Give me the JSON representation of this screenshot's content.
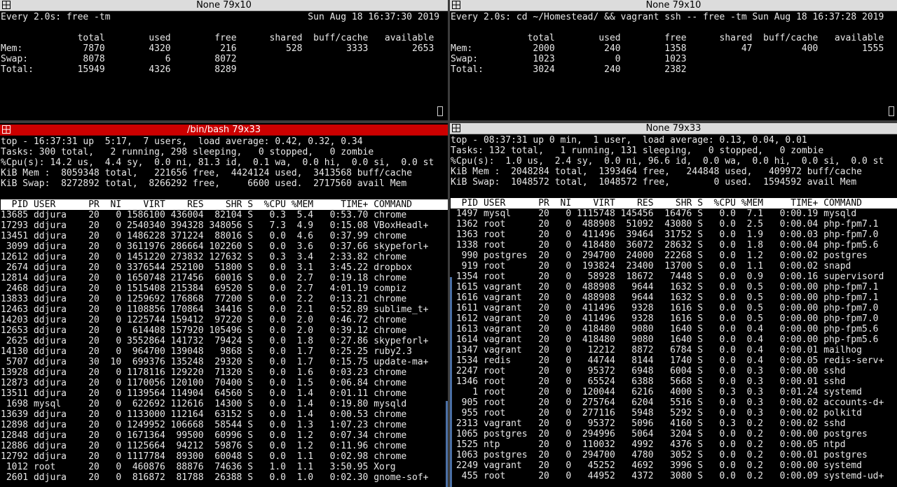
{
  "panes": {
    "top_left": {
      "title": "None 79x10",
      "lines": [
        "Every 2.0s: free -tm                                    Sun Aug 18 16:37:30 2019",
        "",
        "              total        used        free      shared  buff/cache   available",
        "Mem:           7870        4320         216         528        3333        2653",
        "Swap:          8078           6        8072",
        "Total:        15949        4326        8289"
      ]
    },
    "top_right": {
      "title": "None 79x10",
      "lines": [
        "Every 2.0s: cd ~/Homestead/ && vagrant ssh -- free -tm Sun Aug 18 16:37:28 2019",
        "",
        "              total        used        free      shared  buff/cache   available",
        "Mem:           2000         240        1358          47         400        1555",
        "Swap:          1023           0        1023",
        "Total:         3024         240        2382"
      ]
    },
    "bottom_left": {
      "title": "/bin/bash 79x33",
      "summary": [
        "top - 16:37:31 up  5:17,  7 users,  load average: 0.42, 0.32, 0.34",
        "Tasks: 300 total,   2 running, 298 sleeping,   0 stopped,   0 zombie",
        "%Cpu(s): 14.2 us,  4.4 sy,  0.0 ni, 81.3 id,  0.1 wa,  0.0 hi,  0.0 si,  0.0 st",
        "KiB Mem :  8059348 total,   221656 free,  4424124 used,  3413568 buff/cache",
        "KiB Swap:  8272892 total,  8266292 free,     6600 used.  2717560 avail Mem",
        ""
      ],
      "header": "  PID USER      PR  NI    VIRT    RES    SHR S  %CPU %MEM     TIME+ COMMAND     ",
      "rows": [
        "13685 ddjura    20   0 1586100 436004  82104 S   0.3  5.4   0:53.70 chrome",
        "17293 ddjura    20   0 2540340 394328 348056 S   7.3  4.9   0:15.08 VBoxHeadl+",
        "13451 ddjura    20   0 1486228 371224  88016 S   0.0  4.6   0:37.99 chrome",
        " 3099 ddjura    20   0 3611976 286664 102260 S   0.0  3.6   0:37.66 skypeforl+",
        "12612 ddjura    20   0 1451220 273832 127632 S   0.3  3.4   2:33.82 chrome",
        " 2674 ddjura    20   0 3376544 252100  51800 S   0.0  3.1   3:45.22 dropbox",
        "12814 ddjura    20   0 1650748 217456  60016 S   0.0  2.7   0:19.18 chrome",
        " 2468 ddjura    20   0 1515408 215384  69520 S   0.0  2.7   4:01.19 compiz",
        "13833 ddjura    20   0 1259692 176868  77200 S   0.0  2.2   0:13.21 chrome",
        "12463 ddjura    20   0 1108856 170864  34416 S   0.0  2.1   0:52.89 sublime_t+",
        "14203 ddjura    20   0 1225744 159412  97220 S   0.0  2.0   0:46.72 chrome",
        "12653 ddjura    20   0  614408 157920 105496 S   0.0  2.0   0:39.12 chrome",
        " 2625 ddjura    20   0 3552864 141732  79424 S   0.0  1.8   0:27.86 skypeforl+",
        "14130 ddjura    20   0  964700 139048   9868 S   0.0  1.7   0:25.25 ruby2.3",
        " 5707 ddjura    30  10  699376 135248  29320 S   0.0  1.7   0:15.75 update-ma+",
        "13928 ddjura    20   0 1178116 129220  71320 S   0.0  1.6   0:03.23 chrome",
        "12873 ddjura    20   0 1170056 120100  70400 S   0.0  1.5   0:06.84 chrome",
        "13511 ddjura    20   0 1139564 114904  64560 S   0.0  1.4   0:01.11 chrome",
        " 1698 mysql     20   0  622692 112616  14300 S   0.0  1.4   0:19.80 mysqld",
        "13639 ddjura    20   0 1133000 112164  63152 S   0.0  1.4   0:00.53 chrome",
        "12898 ddjura    20   0 1249952 106668  58544 S   0.0  1.3   1:07.23 chrome",
        "12848 ddjura    20   0 1671364  99500  60996 S   0.0  1.2   0:07.34 chrome",
        "12886 ddjura    20   0 1125664  94212  59876 S   0.0  1.2   0:11.96 chrome",
        "12792 ddjura    20   0 1117784  89300  60048 S   0.0  1.1   0:02.98 chrome",
        " 1012 root      20   0  460876  88876  74636 S   1.0  1.1   3:50.95 Xorg",
        " 2601 ddjura    20   0  816872  81788  26388 S   0.0  1.0   0:02.30 gnome-sof+"
      ]
    },
    "bottom_right": {
      "title": "None 79x33",
      "summary": [
        "top - 08:37:31 up 0 min,  1 user,  load average: 0.13, 0.04, 0.01",
        "Tasks: 132 total,   1 running, 131 sleeping,   0 stopped,   0 zombie",
        "%Cpu(s):  1.0 us,  2.4 sy,  0.0 ni, 96.6 id,  0.0 wa,  0.0 hi,  0.0 si,  0.0 st",
        "KiB Mem :  2048284 total,  1393464 free,   244848 used,   409972 buff/cache",
        "KiB Swap:  1048572 total,  1048572 free,        0 used.  1594592 avail Mem",
        ""
      ],
      "header": "  PID USER      PR  NI    VIRT    RES    SHR S  %CPU %MEM     TIME+ COMMAND     ",
      "rows": [
        " 1497 mysql     20   0 1115748 145456  16476 S   0.0  7.1   0:00.19 mysqld",
        " 1362 root      20   0  488908  51092  43080 S   0.0  2.5   0:00.04 php-fpm7.1",
        " 1363 root      20   0  411496  39464  31752 S   0.0  1.9   0:00.03 php-fpm7.0",
        " 1338 root      20   0  418480  36072  28632 S   0.0  1.8   0:00.04 php-fpm5.6",
        "  990 postgres  20   0  294700  24000  22268 S   0.0  1.2   0:00.02 postgres",
        "  919 root      20   0  193824  23400  13700 S   0.0  1.1   0:00.02 snapd",
        " 1354 root      20   0   58928  18672   7448 S   0.0  0.9   0:00.16 supervisord",
        " 1615 vagrant   20   0  488908   9644   1632 S   0.0  0.5   0:00.00 php-fpm7.1",
        " 1616 vagrant   20   0  488908   9644   1632 S   0.0  0.5   0:00.00 php-fpm7.1",
        " 1611 vagrant   20   0  411496   9328   1616 S   0.0  0.5   0:00.00 php-fpm7.0",
        " 1612 vagrant   20   0  411496   9328   1616 S   0.0  0.5   0:00.00 php-fpm7.0",
        " 1613 vagrant   20   0  418480   9080   1640 S   0.0  0.4   0:00.00 php-fpm5.6",
        " 1614 vagrant   20   0  418480   9080   1640 S   0.0  0.4   0:00.00 php-fpm5.6",
        " 1347 vagrant   20   0   12212   8872   6784 S   0.0  0.4   0:00.01 mailhog",
        " 1534 redis     20   0   44744   8144   1740 S   0.0  0.4   0:00.05 redis-serv+",
        " 2247 root      20   0   95372   6948   6004 S   0.0  0.3   0:00.00 sshd",
        " 1346 root      20   0   65524   6388   5668 S   0.0  0.3   0:00.01 sshd",
        "    1 root      20   0  120044   6216   4000 S   0.3  0.3   0:01.24 systemd",
        "  905 root      20   0  275764   6204   5516 S   0.0  0.3   0:00.02 accounts-d+",
        "  955 root      20   0  277116   5948   5292 S   0.0  0.3   0:00.02 polkitd",
        " 2313 vagrant   20   0   95372   5096   4160 S   0.3  0.2   0:00.02 sshd",
        " 1065 postgres  20   0  294996   5064   3204 S   0.0  0.2   0:00.00 postgres",
        " 1525 ntp       20   0  110032   4992   4376 S   0.0  0.2   0:00.05 ntpd",
        " 1063 postgres  20   0  294700   4780   3052 S   0.0  0.2   0:00.01 postgres",
        " 2249 vagrant   20   0   45252   4692   3996 S   0.0  0.2   0:00.00 systemd",
        "  455 root      20   0   44952   4372   3080 S   0.0  0.2   0:00.09 systemd-ud+"
      ]
    }
  }
}
